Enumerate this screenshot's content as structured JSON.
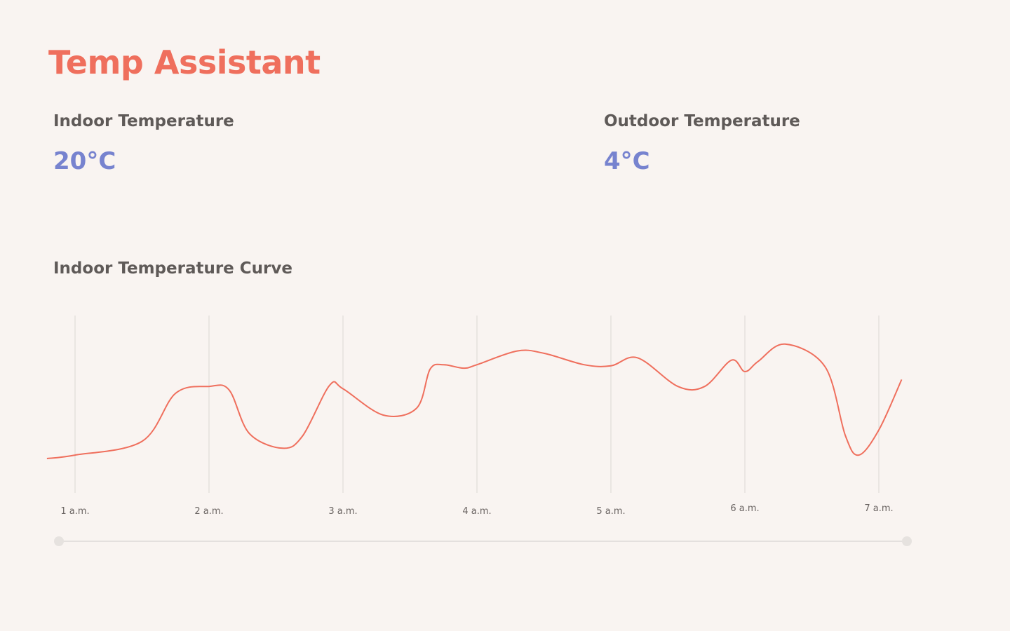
{
  "app": {
    "title": "Temp Assistant"
  },
  "indoor": {
    "label": "Indoor Temperature",
    "value": "20°C"
  },
  "outdoor": {
    "label": "Outdoor Temperature",
    "value": "4°C"
  },
  "curve": {
    "title": "Indoor Temperature Curve"
  },
  "colors": {
    "accent": "#ef6f5d",
    "value": "#7783cf",
    "text": "#5f5a58",
    "background": "#f9f4f1"
  },
  "chart_data": {
    "type": "line",
    "title": "Indoor Temperature Curve",
    "xlabel": "",
    "ylabel": "",
    "categories": [
      "1 a.m.",
      "2 a.m.",
      "3 a.m.",
      "4 a.m.",
      "5 a.m.",
      "6 a.m.",
      "7 a.m."
    ],
    "x": [
      0.79,
      1.0,
      1.5,
      1.75,
      2.0,
      2.15,
      2.3,
      2.55,
      2.7,
      2.9,
      3.0,
      3.3,
      3.55,
      3.65,
      3.75,
      3.9,
      4.0,
      4.3,
      4.5,
      4.8,
      5.0,
      5.2,
      5.5,
      5.7,
      5.9,
      6.0,
      6.1,
      6.3,
      6.6,
      6.75,
      6.85,
      7.0,
      7.17
    ],
    "values": [
      0.3,
      0.33,
      0.45,
      0.87,
      0.93,
      0.9,
      0.52,
      0.39,
      0.5,
      0.94,
      0.91,
      0.68,
      0.74,
      1.08,
      1.12,
      1.09,
      1.12,
      1.24,
      1.22,
      1.12,
      1.11,
      1.18,
      0.93,
      0.93,
      1.16,
      1.06,
      1.15,
      1.3,
      1.1,
      0.5,
      0.33,
      0.55,
      0.99
    ],
    "ylim": [
      0,
      1.55
    ],
    "xlim": [
      0.79,
      7.17
    ],
    "grid": true,
    "legend": "none"
  }
}
